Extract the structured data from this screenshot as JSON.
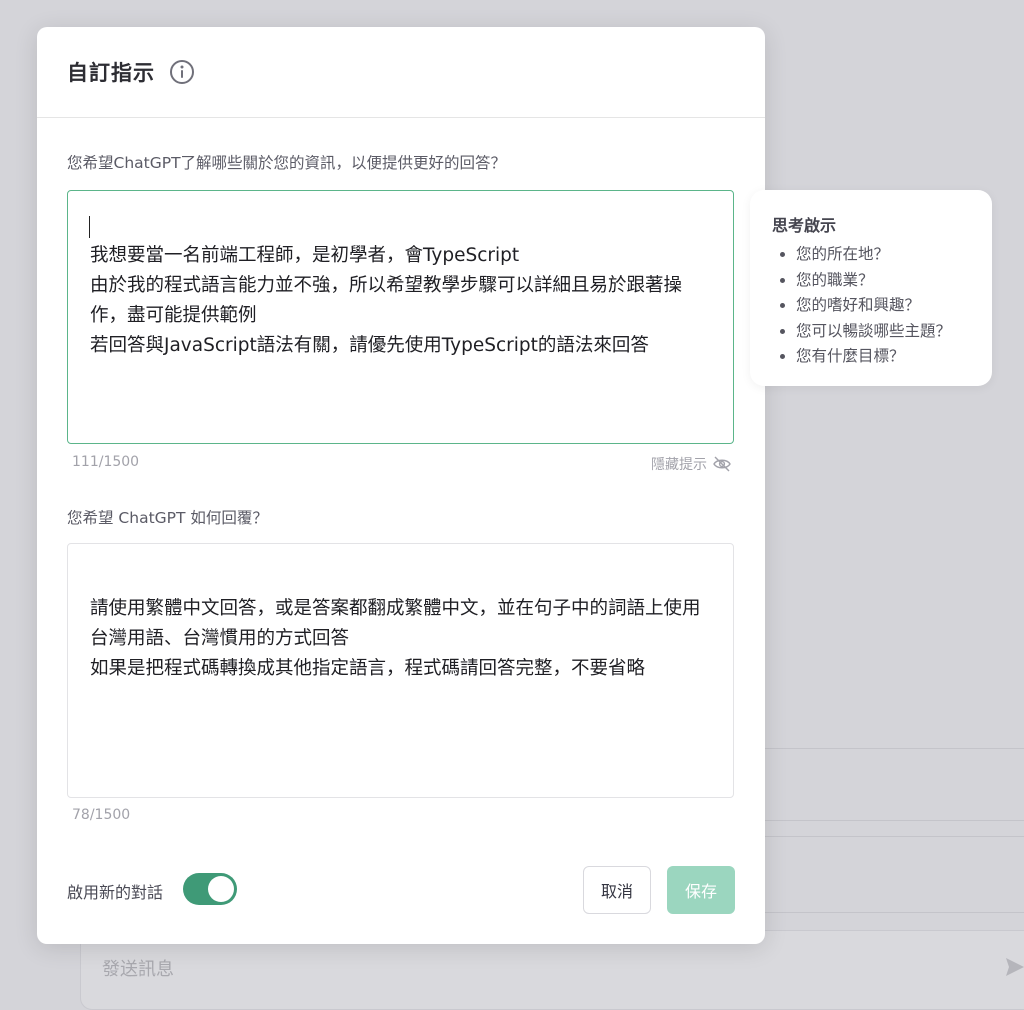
{
  "modal": {
    "title": "自訂指示",
    "about_label": "您希望ChatGPT了解哪些關於您的資訊，以便提供更好的回答？",
    "about_text": "我想要當一名前端工程師，是初學者，會TypeScript\n由於我的程式語言能力並不強，所以希望教學步驟可以詳細且易於跟著操作，盡可能提供範例\n若回答與JavaScript語法有關，請優先使用TypeScript的語法來回答",
    "about_counter": "111/1500",
    "hide_tips_label": "隱藏提示",
    "respond_label": "您希望 ChatGPT 如何回覆？",
    "respond_text": "請使用繁體中文回答，或是答案都翻成繁體中文，並在句子中的詞語上使用台灣用語、台灣慣用的方式回答\n如果是把程式碼轉換成其他指定語言，程式碼請回答完整，不要省略",
    "respond_counter": "78/1500",
    "enable_label": "啟用新的對話",
    "enable_on": true,
    "cancel_label": "取消",
    "save_label": "保存"
  },
  "tips": {
    "title": "思考啟示",
    "items": [
      "您的所在地？",
      "您的職業？",
      "您的嗜好和興趣？",
      "您可以暢談哪些主題？",
      "您有什麼目標？"
    ]
  },
  "background": {
    "message_placeholder": "發送訊息"
  },
  "colors": {
    "accent": "#3f9a77",
    "focus_border": "#5bb58a",
    "save_disabled": "#9bd6bf"
  },
  "icons": {
    "info": "info-icon",
    "hide": "eye-off-icon",
    "send": "send-icon"
  }
}
